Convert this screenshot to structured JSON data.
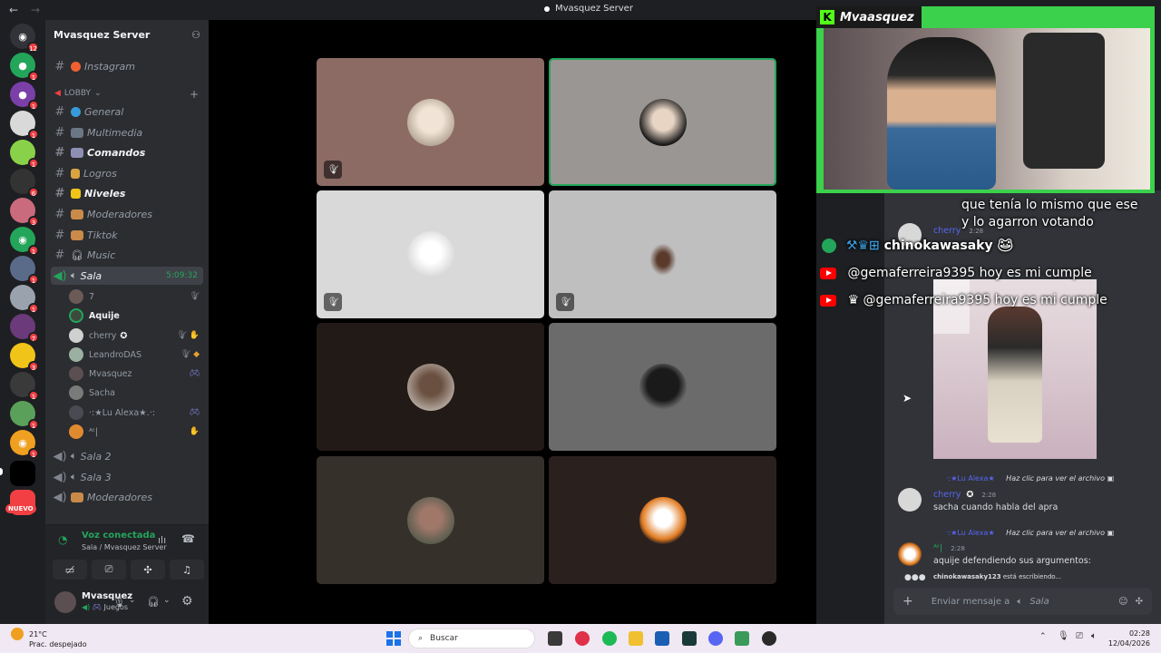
{
  "window": {
    "title": "Mvasquez Server"
  },
  "server": {
    "name": "Mvasquez Server"
  },
  "rail_badges": [
    "12",
    "1",
    "1",
    "1",
    "1",
    "6",
    "3",
    "1",
    "1",
    "1",
    "7",
    "3",
    "1",
    "1",
    "1"
  ],
  "nuevo": "NUEVO",
  "channels": {
    "instagram": "Instagram",
    "lobby_category": "LOBBY",
    "general": "General",
    "multimedia": "Multimedia",
    "comandos": "Comandos",
    "logros": "Logros",
    "niveles": "Niveles",
    "moderadores": "Moderadores",
    "tiktok": "Tiktok",
    "music": "Music",
    "sala": "Sala",
    "sala_time": "5:09:32",
    "sala2": "Sala 2",
    "sala3": "Sala 3",
    "moderadores_voice": "Moderadores"
  },
  "members": [
    "7",
    "Aquije",
    "cherry",
    "LeandroDAS",
    "Mvasquez",
    "Sacha",
    "·:★Lu Alexa★.·:",
    "ᴬᵗ|"
  ],
  "voice_panel": {
    "title": "Voz conectada",
    "subtitle": "Sala / Mvasquez Server"
  },
  "user_panel": {
    "name": "Mvasquez",
    "status": "Juegos"
  },
  "stream": {
    "channel_name": "Mvaasquez",
    "chat_line1": "que tenía lo mismo que ese",
    "chat_line2": "y lo agarron votando",
    "kick_user": "chinokawasaky",
    "yt_msg1_user": "@gemaferreira9395",
    "yt_msg1_text": "hoy es mi cumple",
    "yt_msg2_user": "@gemaferreira9395",
    "yt_msg2_text": "hoy es mi cumple"
  },
  "chat": {
    "top_author": "cherry",
    "top_time": "2:28",
    "msg1_ref_user": "·:★Lu Alexa★",
    "msg1_ref_text": "Haz clic para ver el archivo",
    "msg1_author": "cherry",
    "msg1_time": "2:28",
    "msg1_text": "sacha cuando habla del apra",
    "msg2_ref_user": "·:★Lu Alexa★",
    "msg2_ref_text": "Haz clic para ver el archivo",
    "msg2_author": "ᴬᵗ|",
    "msg2_time": "2:28",
    "msg2_text": "aquije defendiendo sus argumentos:",
    "typing_user": "chinokawasaky123",
    "typing_suffix": "está escribiendo...",
    "input_placeholder": "Enviar mensaje a",
    "input_channel": "Sala"
  },
  "taskbar": {
    "temperature": "21°C",
    "weather": "Prac. despejado",
    "search": "Buscar",
    "time": "02:28",
    "date": "12/04/2026"
  }
}
